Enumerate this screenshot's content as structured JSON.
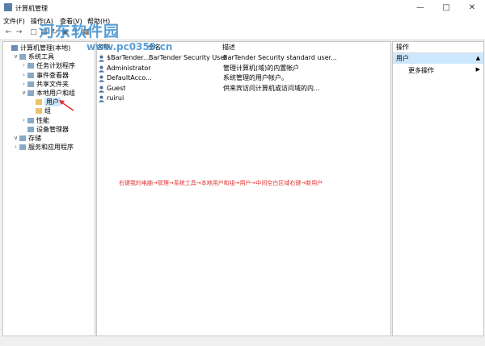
{
  "window": {
    "title": "计算机管理"
  },
  "menu": [
    "文件(F)",
    "操作(A)",
    "查看(V)",
    "帮助(H)"
  ],
  "watermark": {
    "text": "河东软件园",
    "url": "www.pc0359.cn"
  },
  "tree": [
    {
      "label": "计算机管理(本地)",
      "indent": 0,
      "toggle": ""
    },
    {
      "label": "系统工具",
      "indent": 1,
      "toggle": "v"
    },
    {
      "label": "任务计划程序",
      "indent": 2,
      "toggle": ">"
    },
    {
      "label": "事件查看器",
      "indent": 2,
      "toggle": ">"
    },
    {
      "label": "共享文件夹",
      "indent": 2,
      "toggle": ">"
    },
    {
      "label": "本地用户和组",
      "indent": 2,
      "toggle": "v"
    },
    {
      "label": "用户",
      "indent": 3,
      "toggle": "",
      "selected": true
    },
    {
      "label": "组",
      "indent": 3,
      "toggle": ""
    },
    {
      "label": "性能",
      "indent": 2,
      "toggle": ">"
    },
    {
      "label": "设备管理器",
      "indent": 2,
      "toggle": ""
    },
    {
      "label": "存储",
      "indent": 1,
      "toggle": "v"
    },
    {
      "label": "服务和应用程序",
      "indent": 1,
      "toggle": ">"
    }
  ],
  "list": {
    "headers": {
      "name": "名称",
      "fullname": "全名",
      "description": "描述"
    },
    "rows": [
      {
        "name": "$BarTender...",
        "fullname": "BarTender Security User",
        "description": "BarTender Security standard user..."
      },
      {
        "name": "Administrator",
        "fullname": "",
        "description": "管理计算机(域)的内置帐户"
      },
      {
        "name": "DefaultAcco...",
        "fullname": "",
        "description": "系统管理的用户帐户。"
      },
      {
        "name": "Guest",
        "fullname": "",
        "description": "供来宾访问计算机或访问域的内..."
      },
      {
        "name": "ruirui",
        "fullname": "",
        "description": ""
      }
    ]
  },
  "annotation": "右键我的电脑→管理→系统工具→本地用户和组→用户→中间空白区域右键→新用户",
  "actions": {
    "header": "操作",
    "section": "用户",
    "more": "更多操作"
  },
  "colors": {
    "annotation": "#e0302e",
    "selection": "#cce8ff",
    "watermark": "#3d8fd1"
  }
}
